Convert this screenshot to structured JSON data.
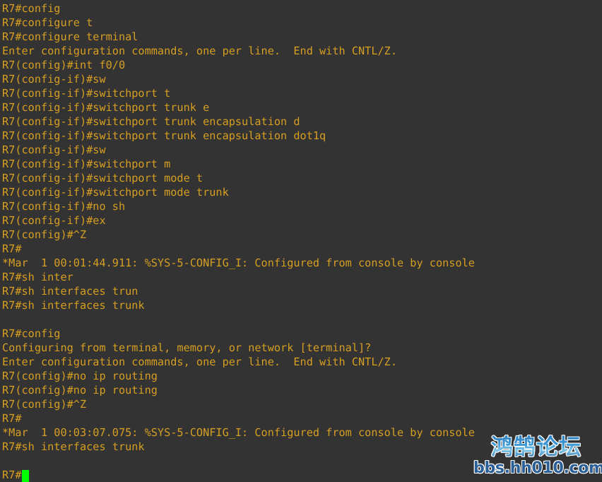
{
  "terminal": {
    "device": "R7",
    "background_color": "#333333",
    "text_color": "#d79f21",
    "cursor_color": "#00ff00",
    "lines": [
      "R7#config",
      "R7#configure t",
      "R7#configure terminal",
      "Enter configuration commands, one per line.  End with CNTL/Z.",
      "R7(config)#int f0/0",
      "R7(config-if)#sw",
      "R7(config-if)#switchport t",
      "R7(config-if)#switchport trunk e",
      "R7(config-if)#switchport trunk encapsulation d",
      "R7(config-if)#switchport trunk encapsulation dot1q",
      "R7(config-if)#sw",
      "R7(config-if)#switchport m",
      "R7(config-if)#switchport mode t",
      "R7(config-if)#switchport mode trunk",
      "R7(config-if)#no sh",
      "R7(config-if)#ex",
      "R7(config)#^Z",
      "R7#",
      "*Mar  1 00:01:44.911: %SYS-5-CONFIG_I: Configured from console by console",
      "R7#sh inter",
      "R7#sh interfaces trun",
      "R7#sh interfaces trunk",
      "",
      "R7#config",
      "Configuring from terminal, memory, or network [terminal]?",
      "Enter configuration commands, one per line.  End with CNTL/Z.",
      "R7(config)#no ip routing",
      "R7(config)#no ip routing",
      "R7(config)#^Z",
      "R7#",
      "*Mar  1 00:03:07.075: %SYS-5-CONFIG_I: Configured from console by console",
      "R7#sh interfaces trunk",
      ""
    ],
    "prompt_line": "R7#"
  },
  "watermark": {
    "title": "鸿鹄论坛",
    "url": "bbs.hh010.com",
    "title_color": "#3e9ad6",
    "url_color": "#2a5f97"
  }
}
